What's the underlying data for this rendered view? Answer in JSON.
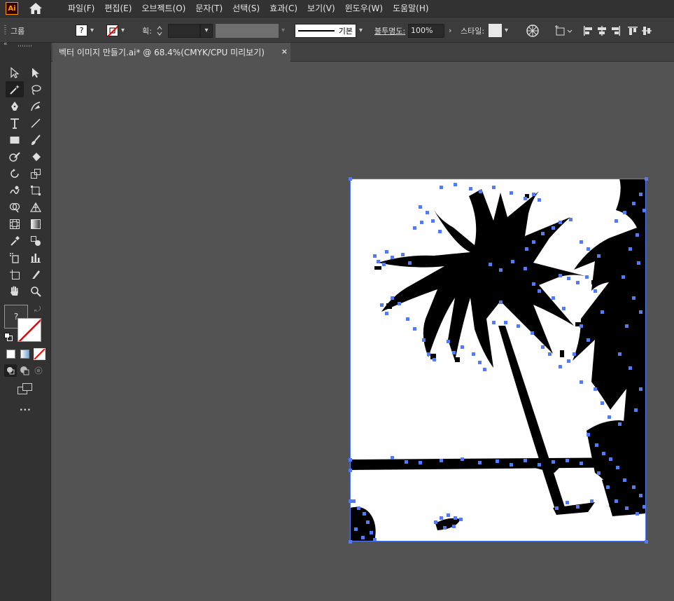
{
  "app": {
    "logo_text": "Ai",
    "home_icon": "home-icon"
  },
  "menu": [
    "파일(F)",
    "편집(E)",
    "오브젝트(O)",
    "문자(T)",
    "선택(S)",
    "효과(C)",
    "보기(V)",
    "윈도우(W)",
    "도움말(H)"
  ],
  "control_bar": {
    "selection_label": "그룹",
    "fill_label": "?",
    "stroke_weight_label": "획:",
    "stroke_value": "",
    "stroke_style_label": "기본",
    "opacity_label": "불투명도:",
    "opacity_value": "100%",
    "style_label": "스타일:"
  },
  "document_tab": {
    "title": "벡터 이미지 만들기.ai* @ 68.4%(CMYK/CPU 미리보기)",
    "close": "×"
  },
  "toolbar": {
    "fill_stroke_unknown": "?",
    "more": "..."
  },
  "colors": {
    "selection": "#4f7bff",
    "artboard": "#ffffff",
    "canvas": "#535353",
    "accent_logo": "#ff9a00"
  }
}
